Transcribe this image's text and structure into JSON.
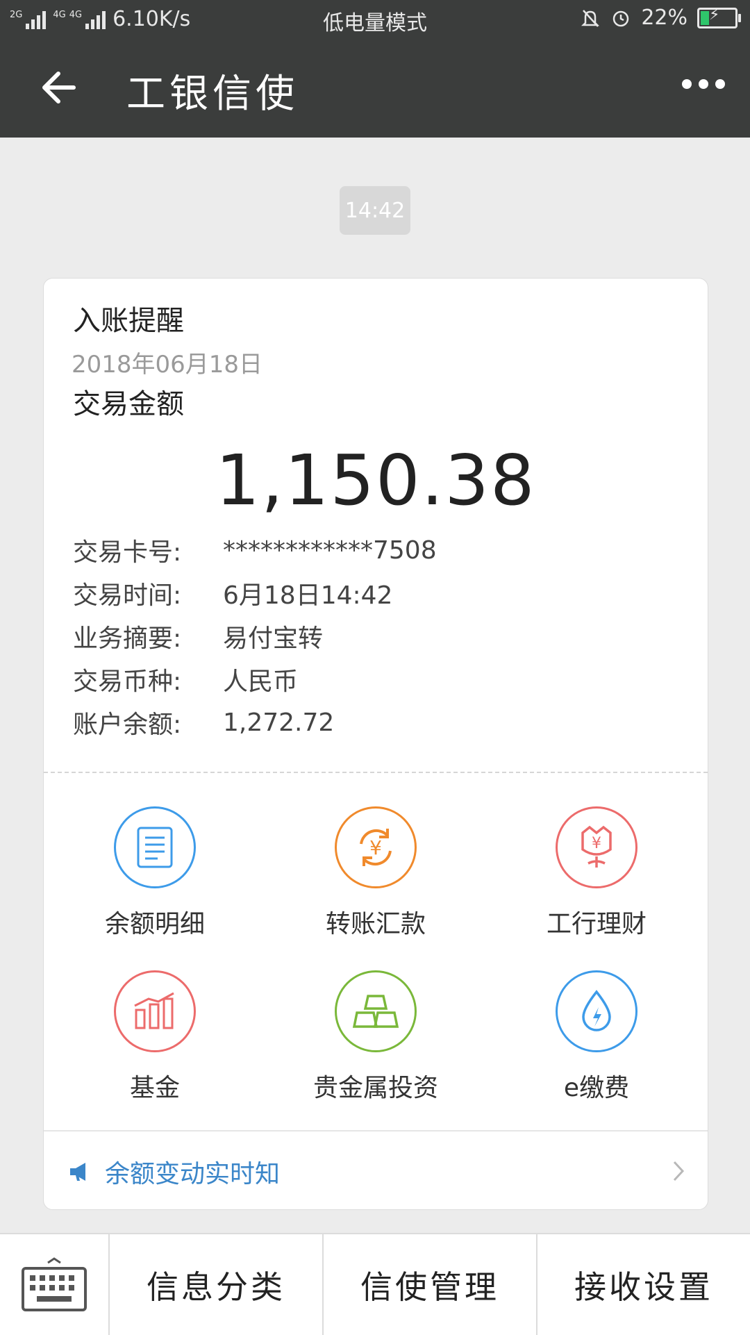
{
  "status_bar": {
    "net1": "2G",
    "net2": "4G",
    "net3": "4G",
    "speed": "6.10K/s",
    "mode": "低电量模式",
    "battery": "22%",
    "battery_level": 0.22
  },
  "header": {
    "title": "工银信使"
  },
  "time_pill": "14:42",
  "card": {
    "title": "入账提醒",
    "date": "2018年06月18日",
    "amount_label": "交易金额",
    "amount": "1,150.38",
    "details": [
      {
        "key": "交易卡号:",
        "value": "************7508"
      },
      {
        "key": "交易时间:",
        "value": "6月18日14:42"
      },
      {
        "key": "业务摘要:",
        "value": "易付宝转"
      },
      {
        "key": "交易币种:",
        "value": "人民币"
      },
      {
        "key": "账户余额:",
        "value": "1,272.72"
      }
    ],
    "actions": [
      {
        "label": "余额明细",
        "icon": "document-icon",
        "color": "#3d9be9"
      },
      {
        "label": "转账汇款",
        "icon": "yuan-transfer-icon",
        "color": "#f08a2c"
      },
      {
        "label": "工行理财",
        "icon": "rose-yuan-icon",
        "color": "#ec6b6b"
      },
      {
        "label": "基金",
        "icon": "chart-bars-icon",
        "color": "#ec6b6b"
      },
      {
        "label": "贵金属投资",
        "icon": "gold-bars-icon",
        "color": "#7ab83a"
      },
      {
        "label": "e缴费",
        "icon": "water-drop-icon",
        "color": "#3d9be9"
      }
    ],
    "notice": "余额变动实时知",
    "notice_color": "#3b86c9"
  },
  "bottom_bar": {
    "tabs": [
      "信息分类",
      "信使管理",
      "接收设置"
    ]
  }
}
